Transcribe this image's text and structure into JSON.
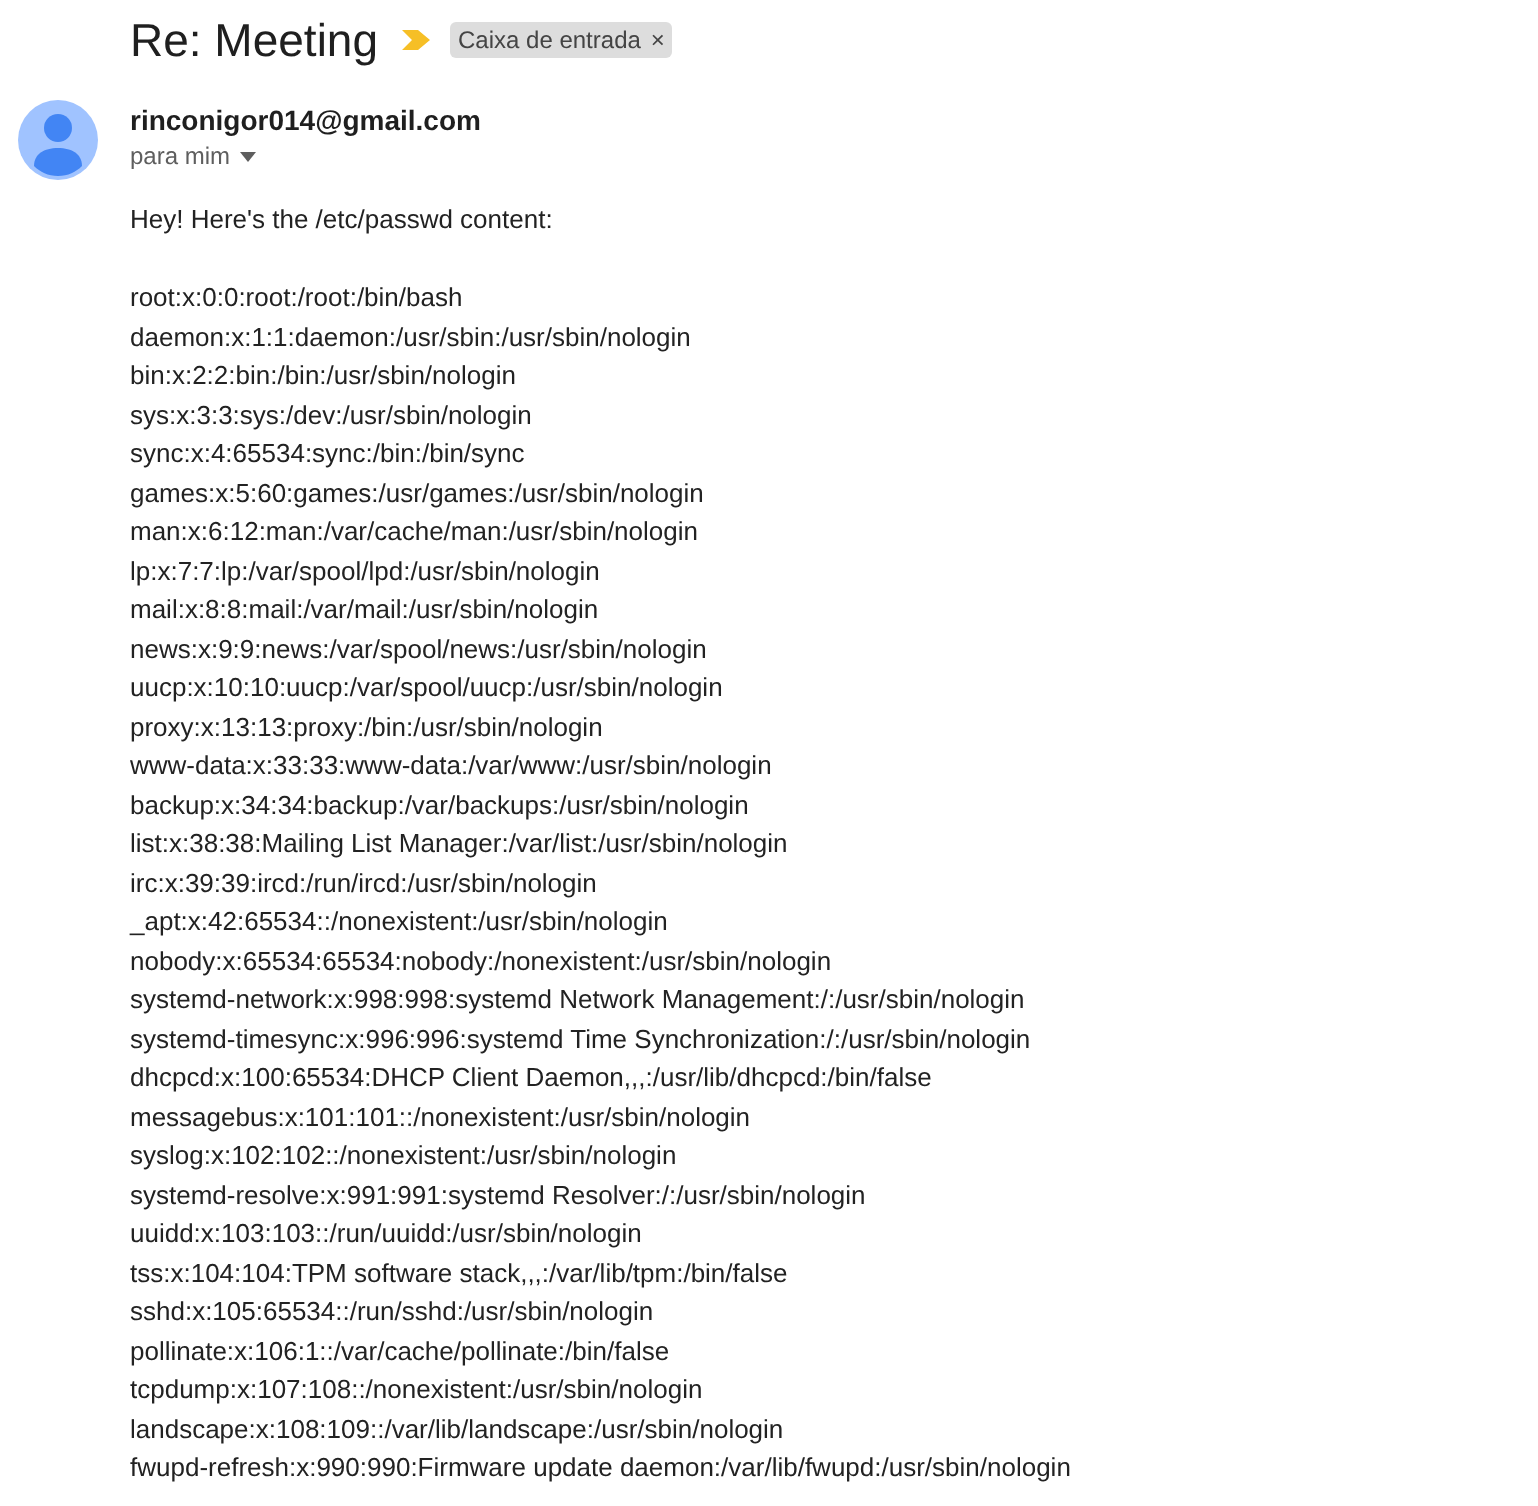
{
  "subject": "Re: Meeting",
  "label": {
    "text": "Caixa de entrada",
    "close": "×"
  },
  "message": {
    "sender": "rinconigor014@gmail.com",
    "recipient": "para mim",
    "greeting": "Hey! Here's the /etc/passwd content:",
    "lines": [
      "root:x:0:0:root:/root:/bin/bash",
      "daemon:x:1:1:daemon:/usr/sbin:/usr/sbin/nologin",
      "bin:x:2:2:bin:/bin:/usr/sbin/nologin",
      "sys:x:3:3:sys:/dev:/usr/sbin/nologin",
      "sync:x:4:65534:sync:/bin:/bin/sync",
      "games:x:5:60:games:/usr/games:/usr/sbin/nologin",
      "man:x:6:12:man:/var/cache/man:/usr/sbin/nologin",
      "lp:x:7:7:lp:/var/spool/lpd:/usr/sbin/nologin",
      "mail:x:8:8:mail:/var/mail:/usr/sbin/nologin",
      "news:x:9:9:news:/var/spool/news:/usr/sbin/nologin",
      "uucp:x:10:10:uucp:/var/spool/uucp:/usr/sbin/nologin",
      "proxy:x:13:13:proxy:/bin:/usr/sbin/nologin",
      "www-data:x:33:33:www-data:/var/www:/usr/sbin/nologin",
      "backup:x:34:34:backup:/var/backups:/usr/sbin/nologin",
      "list:x:38:38:Mailing List Manager:/var/list:/usr/sbin/nologin",
      "irc:x:39:39:ircd:/run/ircd:/usr/sbin/nologin",
      "_apt:x:42:65534::/nonexistent:/usr/sbin/nologin",
      "nobody:x:65534:65534:nobody:/nonexistent:/usr/sbin/nologin",
      "systemd-network:x:998:998:systemd Network Management:/:/usr/sbin/nologin",
      "systemd-timesync:x:996:996:systemd Time Synchronization:/:/usr/sbin/nologin",
      "dhcpcd:x:100:65534:DHCP Client Daemon,,,:/usr/lib/dhcpcd:/bin/false",
      "messagebus:x:101:101::/nonexistent:/usr/sbin/nologin",
      "syslog:x:102:102::/nonexistent:/usr/sbin/nologin",
      "systemd-resolve:x:991:991:systemd Resolver:/:/usr/sbin/nologin",
      "uuidd:x:103:103::/run/uuidd:/usr/sbin/nologin",
      "tss:x:104:104:TPM software stack,,,:/var/lib/tpm:/bin/false",
      "sshd:x:105:65534::/run/sshd:/usr/sbin/nologin",
      "pollinate:x:106:1::/var/cache/pollinate:/bin/false",
      "tcpdump:x:107:108::/nonexistent:/usr/sbin/nologin",
      "landscape:x:108:109::/var/lib/landscape:/usr/sbin/nologin",
      "fwupd-refresh:x:990:990:Firmware update daemon:/var/lib/fwupd:/usr/sbin/nologin"
    ]
  }
}
